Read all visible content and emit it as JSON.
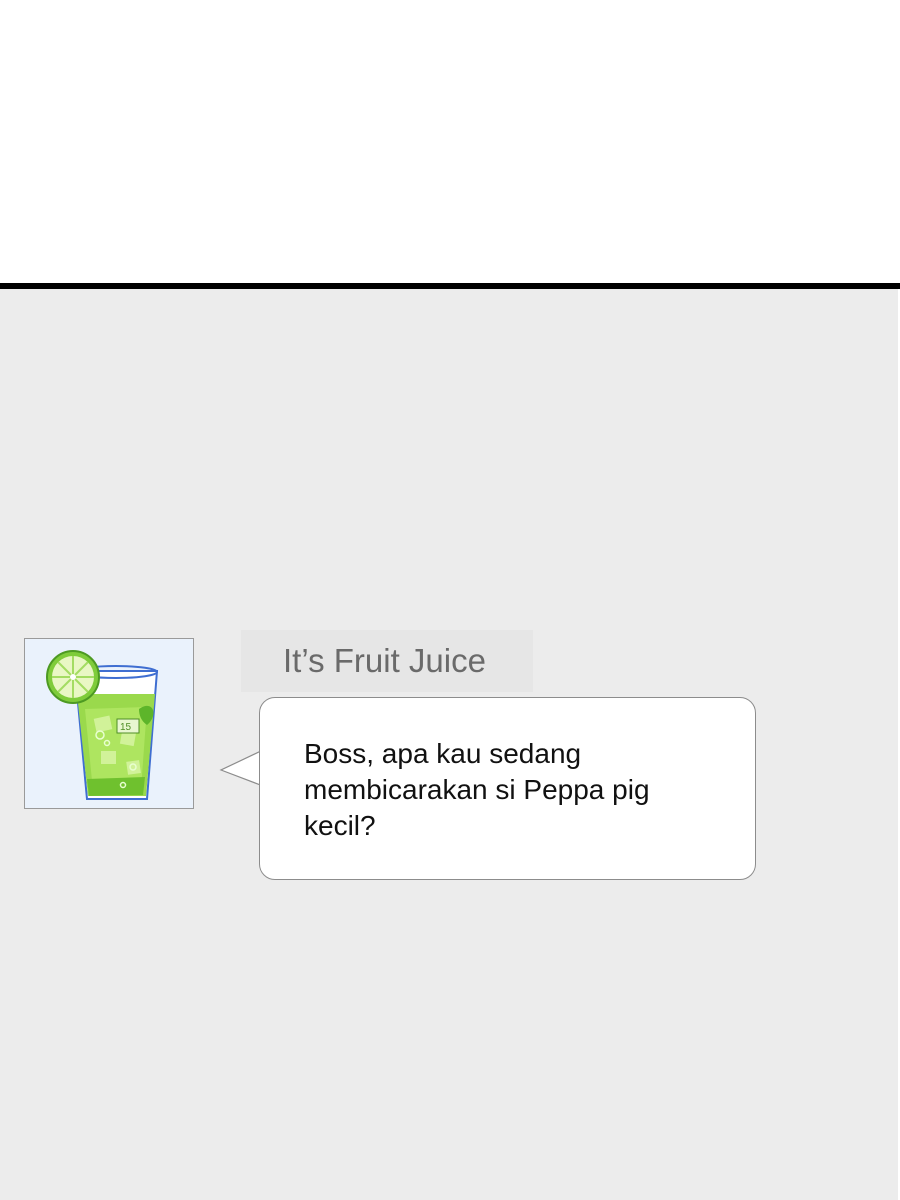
{
  "chat": {
    "sender_name": "It’s Fruit Juice",
    "message_text": "Boss, apa kau sedang membicarakan si Peppa pig kecil?",
    "avatar_icon": "fruit-juice-glass-icon",
    "avatar_glass_label": "15"
  },
  "colors": {
    "background": "#ececec",
    "divider": "#000000",
    "bubble": "#ffffff",
    "bubble_border": "#8c8c8c",
    "sender_name": "#6a6a6a",
    "juice_green": "#8fd43a"
  }
}
